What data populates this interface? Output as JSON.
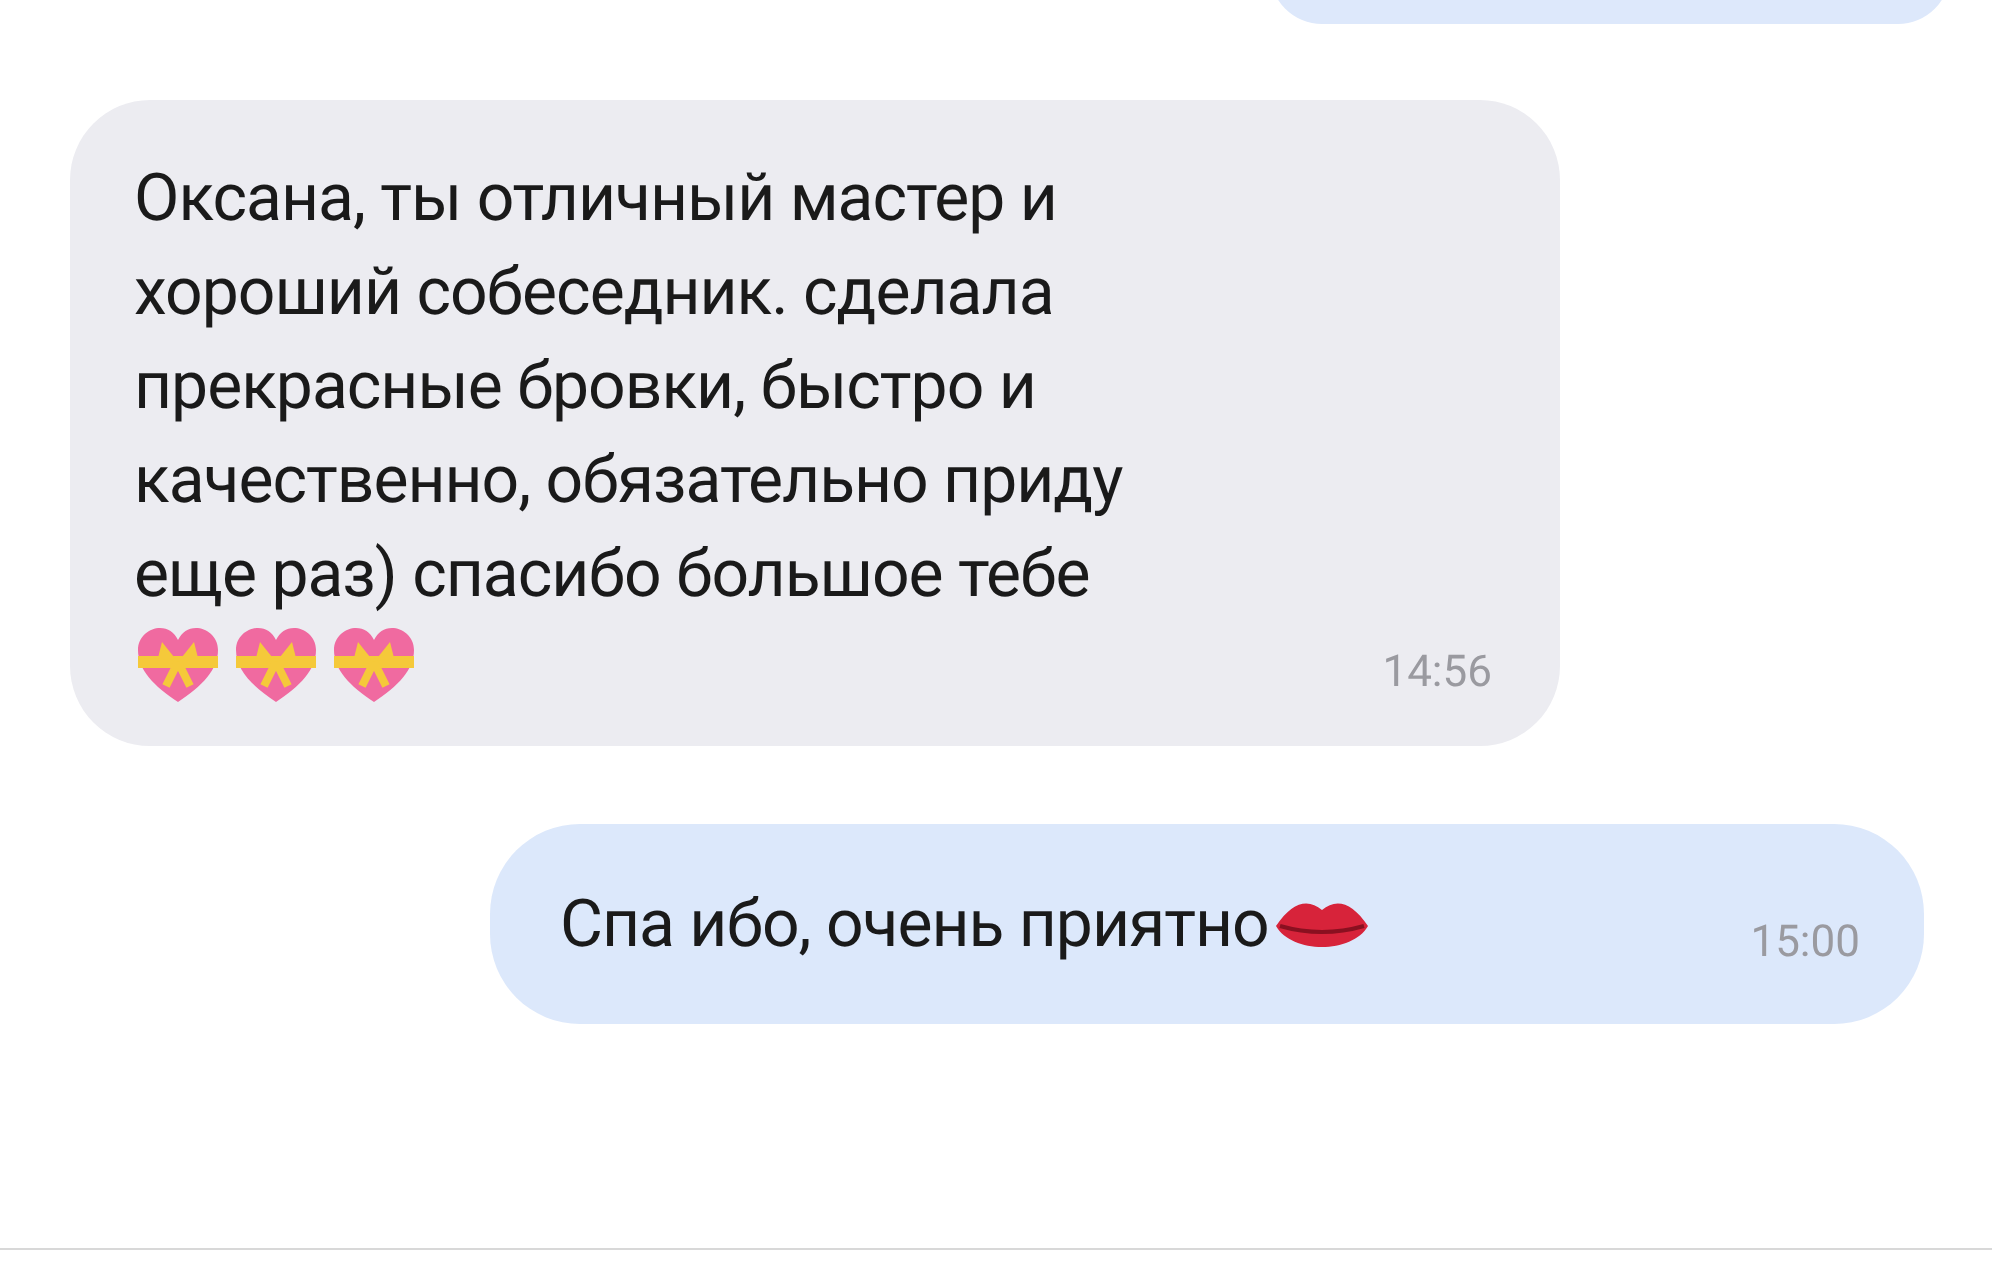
{
  "messages": [
    {
      "kind": "incoming",
      "text": "Оксана, ты отличный мастер и\nхороший собеседник. сделала\nпрекрасные бровки, быстро и\nкачественно, обязательно приду\nеще раз) спасибо большое тебе",
      "emojis": [
        {
          "kind": "gift-heart"
        },
        {
          "kind": "gift-heart"
        },
        {
          "kind": "gift-heart"
        }
      ],
      "time": "14:56"
    },
    {
      "kind": "outgoing",
      "text": "Спа ибо, очень приятно",
      "emojis": [
        {
          "kind": "kiss"
        }
      ],
      "time": "15:00"
    }
  ]
}
